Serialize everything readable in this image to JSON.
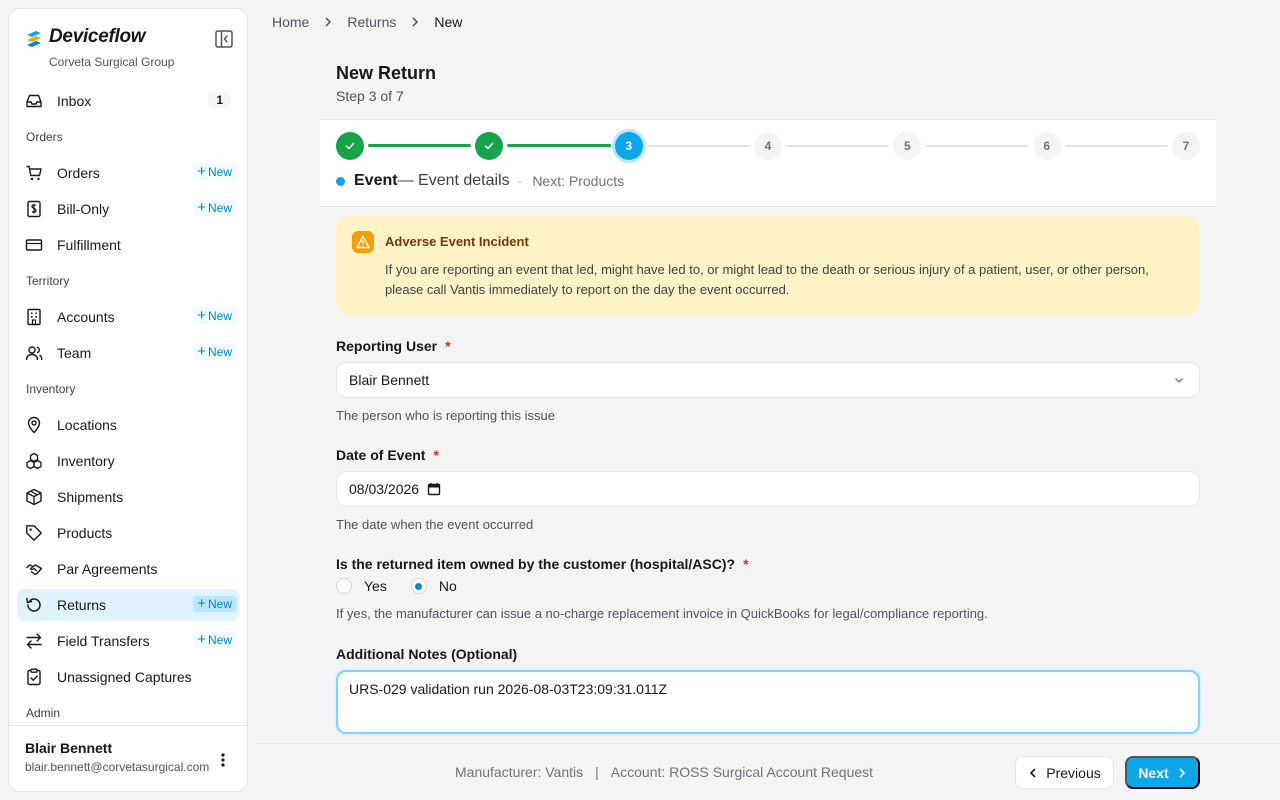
{
  "app": {
    "brand_name": "Deviceflow",
    "org_name": "Corveta Surgical Group"
  },
  "sidebar": {
    "items": [
      {
        "type": "item",
        "label": "Inbox",
        "icon": "inbox-icon",
        "count": "1"
      },
      {
        "type": "section",
        "label": "Orders"
      },
      {
        "type": "item",
        "label": "Orders",
        "icon": "cart-icon",
        "new": "New"
      },
      {
        "type": "item",
        "label": "Bill-Only",
        "icon": "receipt-icon",
        "new": "New"
      },
      {
        "type": "item",
        "label": "Fulfillment",
        "icon": "truck-icon"
      },
      {
        "type": "section",
        "label": "Territory"
      },
      {
        "type": "item",
        "label": "Accounts",
        "icon": "building-icon",
        "new": "New"
      },
      {
        "type": "item",
        "label": "Team",
        "icon": "users-icon",
        "new": "New"
      },
      {
        "type": "section",
        "label": "Inventory"
      },
      {
        "type": "item",
        "label": "Locations",
        "icon": "map-pin-icon"
      },
      {
        "type": "item",
        "label": "Inventory",
        "icon": "boxes-icon"
      },
      {
        "type": "item",
        "label": "Shipments",
        "icon": "package-icon"
      },
      {
        "type": "item",
        "label": "Products",
        "icon": "tag-icon"
      },
      {
        "type": "item",
        "label": "Par Agreements",
        "icon": "handshake-icon"
      },
      {
        "type": "item",
        "label": "Returns",
        "icon": "return-icon",
        "new": "New",
        "active": true
      },
      {
        "type": "item",
        "label": "Field Transfers",
        "icon": "transfer-icon",
        "new": "New"
      },
      {
        "type": "item",
        "label": "Unassigned Captures",
        "icon": "clipboard-icon"
      },
      {
        "type": "section",
        "label": "Admin"
      }
    ],
    "user": {
      "name": "Blair Bennett",
      "email": "blair.bennett@corvetasurgical.com"
    }
  },
  "breadcrumb": [
    "Home",
    "Returns",
    "New"
  ],
  "page": {
    "title": "New Return",
    "step_text": "Step 3 of 7"
  },
  "stepper": {
    "steps": [
      "1",
      "2",
      "3",
      "4",
      "5",
      "6",
      "7"
    ],
    "current": 3,
    "current_name": "Event",
    "current_desc": "— Event details",
    "separator": "·",
    "next_text": "Next: Products"
  },
  "alert": {
    "title": "Adverse Event Incident",
    "body": "If you are reporting an event that led, might have led to, or might lead to the death or serious injury of a patient, user, or other person, please call Vantis immediately to report on the day the event occurred."
  },
  "form": {
    "reporting_user": {
      "label": "Reporting User",
      "required": "*",
      "value": "Blair Bennett",
      "help": "The person who is reporting this issue"
    },
    "date_of_event": {
      "label": "Date of Event",
      "required": "*",
      "value": "08/03/2026",
      "help": "The date when the event occurred"
    },
    "customer_owned": {
      "label": "Is the returned item owned by the customer (hospital/ASC)?",
      "required": "*",
      "options": [
        "Yes",
        "No"
      ],
      "selected": "No",
      "help": "If yes, the manufacturer can issue a no-charge replacement invoice in QuickBooks for legal/compliance reporting."
    },
    "notes": {
      "label": "Additional Notes (Optional)",
      "value": "URS-029 validation run 2026-08-03T23:09:31.011Z"
    }
  },
  "footer": {
    "manufacturer": "Manufacturer: Vantis",
    "divider": "|",
    "account": "Account: ROSS Surgical Account Request",
    "prev_label": "Previous",
    "next_label": "Next"
  },
  "colors": {
    "accent": "#0ea5e9",
    "done": "#16a34a",
    "alert_bg": "#fef3c7",
    "active_nav_bg": "#e0f2fe"
  }
}
